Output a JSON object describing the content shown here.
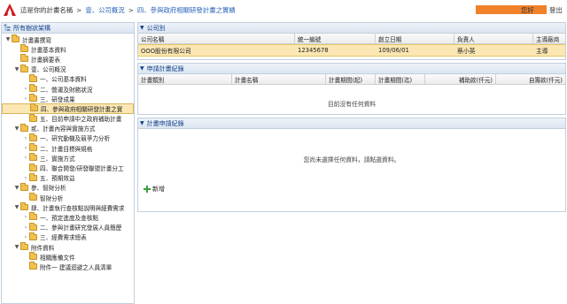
{
  "header": {
    "breadcrumb_root": "這是你的計畫名稱",
    "breadcrumb_sep": ">",
    "breadcrumb_items": [
      "壹、公司概況",
      "四、參與政府相關研發計畫之實績"
    ],
    "greeting": "您好",
    "logout": "登出"
  },
  "sidebar": {
    "title": "所有樹狀架構",
    "nodes": [
      {
        "label": "計畫書撰寫",
        "level": 0,
        "arrow": "▼"
      },
      {
        "label": "計畫基本資料",
        "level": 1,
        "arrow": ""
      },
      {
        "label": "計畫摘要表",
        "level": 1,
        "arrow": ""
      },
      {
        "label": "壹、公司概況",
        "level": 1,
        "arrow": "▼"
      },
      {
        "label": "一、公司基本資料",
        "level": 2,
        "arrow": ""
      },
      {
        "label": "二、營運及財務狀況",
        "level": 2,
        "arrow": "›"
      },
      {
        "label": "三、研發成果",
        "level": 2,
        "arrow": "›"
      },
      {
        "label": "四、參與政府相關研發計畫之實",
        "level": 2,
        "arrow": "",
        "selected": true
      },
      {
        "label": "五、目前申請中之政府補助計畫",
        "level": 2,
        "arrow": ""
      },
      {
        "label": "貳、計畫內容與實施方式",
        "level": 1,
        "arrow": "▼"
      },
      {
        "label": "一、研究動機及競爭力分析",
        "level": 2,
        "arrow": "›"
      },
      {
        "label": "二、計畫目標與規格",
        "level": 2,
        "arrow": "›"
      },
      {
        "label": "三、實施方式",
        "level": 2,
        "arrow": "›"
      },
      {
        "label": "四、聯合開發/研發聯盟計畫分工",
        "level": 2,
        "arrow": ""
      },
      {
        "label": "五、預期效益",
        "level": 2,
        "arrow": "›"
      },
      {
        "label": "參、智財分析",
        "level": 1,
        "arrow": "▼"
      },
      {
        "label": "智財分析",
        "level": 2,
        "arrow": ""
      },
      {
        "label": "肆、計畫執行查核點說明與經費需求",
        "level": 1,
        "arrow": "▼"
      },
      {
        "label": "一、預定進度及查核點",
        "level": 2,
        "arrow": "›"
      },
      {
        "label": "二、參與計畫研究發展人員簡歷",
        "level": 2,
        "arrow": "›"
      },
      {
        "label": "三、經費需求總表",
        "level": 2,
        "arrow": "›"
      },
      {
        "label": "附件資料",
        "level": 1,
        "arrow": "▼"
      },
      {
        "label": "相關應備文件",
        "level": 2,
        "arrow": ""
      },
      {
        "label": "附件一 建議迴避之人員清單",
        "level": 2,
        "arrow": ""
      }
    ]
  },
  "company_panel": {
    "title": "公司別",
    "columns": [
      "公司名稱",
      "統一編號",
      "創立日期",
      "負責人",
      "主導廠商"
    ],
    "row": [
      "OOO股份有限公司",
      "12345678",
      "109/06/01",
      "蔡小英",
      "主導"
    ]
  },
  "application_panel": {
    "title": "申請計畫紀錄",
    "columns": [
      "計畫類別",
      "計畫名稱",
      "計畫期間(起)",
      "計畫期間(迄)",
      "補助款(仟元)",
      "自籌款(仟元)"
    ],
    "empty_message": "目前沒有任何資料"
  },
  "record_panel": {
    "title": "計畫申請紀錄",
    "empty_message": "您尚未選擇任何資料，請點選資料。",
    "add_label": "新增"
  },
  "colors": {
    "accent": "#2a64b8",
    "panel_header": "#dbe5f1",
    "selected_row": "#fbe7b3",
    "user_badge": "#f0822b"
  }
}
